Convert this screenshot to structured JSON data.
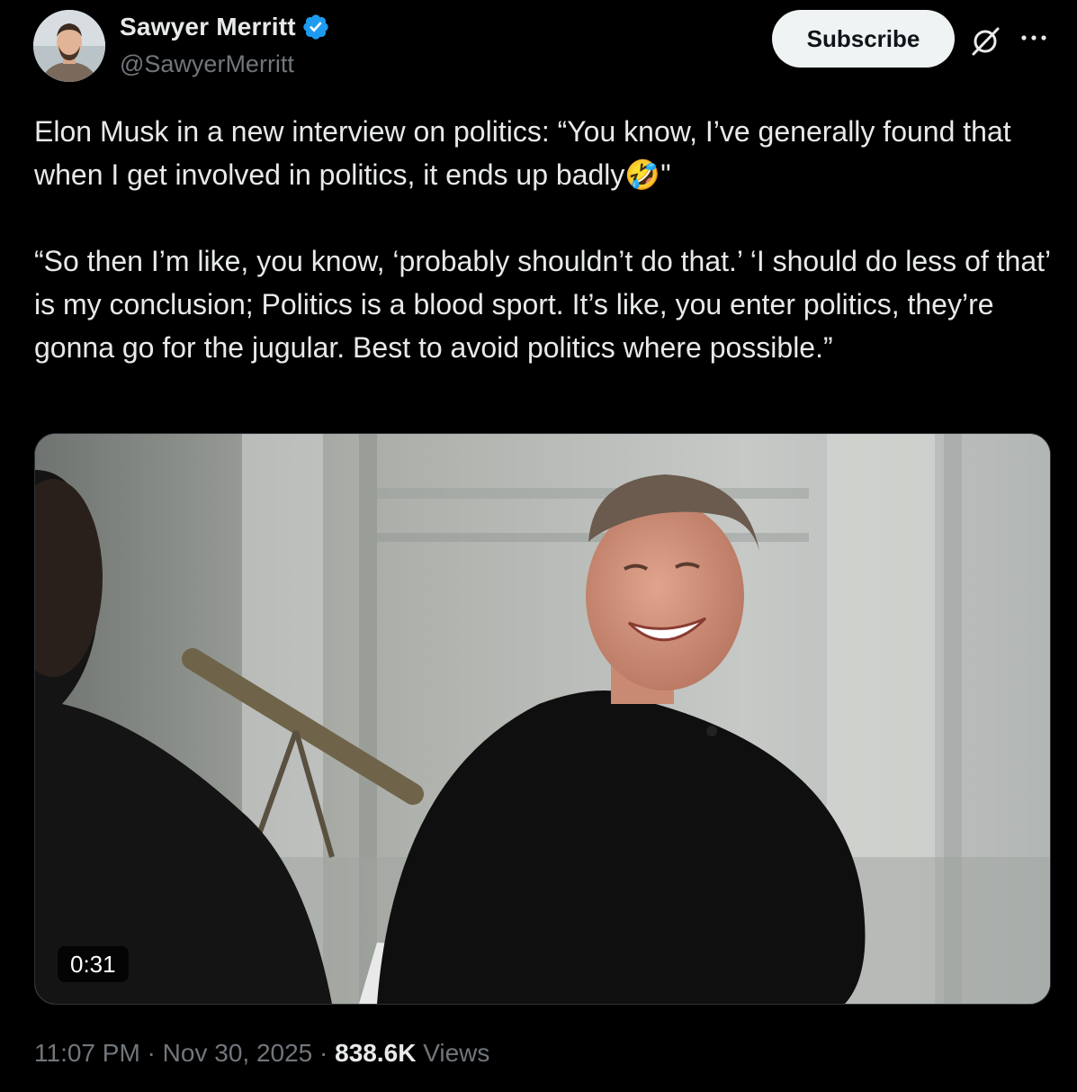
{
  "author": {
    "display_name": "Sawyer Merritt",
    "handle": "@SawyerMerritt",
    "verified_icon": "verified-badge-icon",
    "verified_color": "#1d9bf0"
  },
  "actions": {
    "subscribe_label": "Subscribe",
    "grok_icon": "grok-icon",
    "more_icon": "more-icon"
  },
  "tweet": {
    "text_part1": "Elon Musk in a new interview on politics: “You know, I’ve generally found that when I get involved in politics, it ends up badly",
    "emoji": "🤣",
    "text_part2": "\"\n\n“So then I’m like, you know, ‘probably shouldn’t do that.’ ‘I should do less of that’ is my conclusion; Politics is a blood sport. It’s like, you enter politics, they’re gonna go for the jugular. Best to avoid politics where possible.”"
  },
  "media": {
    "type": "video",
    "duration": "0:31"
  },
  "meta": {
    "time": "11:07 PM",
    "separator": " · ",
    "date": "Nov 30, 2025",
    "views_count": "838.6K",
    "views_label": " Views"
  },
  "colors": {
    "background": "#000000",
    "text": "#e7e9ea",
    "secondary": "#71767b",
    "button_bg": "#eff3f4"
  }
}
